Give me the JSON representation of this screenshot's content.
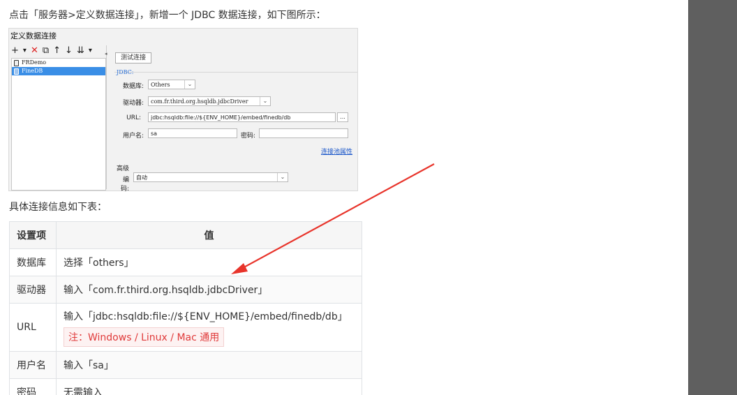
{
  "intro_text": "点击「服务器>定义数据连接」，新增一个 JDBC 数据连接，如下图所示：",
  "dialog": {
    "title": "定义数据连接",
    "toolbar": [
      "+",
      "▾",
      "✕",
      "⧉",
      "↑",
      "↓",
      "⇊",
      "▾"
    ],
    "connections": [
      {
        "name": "FRDemo",
        "selected": false
      },
      {
        "name": "FineDB",
        "selected": true
      }
    ],
    "test_button": "测试连接",
    "jdbc_legend": "JDBC:",
    "database_label": "数据库:",
    "database_value": "Others",
    "driver_label": "驱动器:",
    "driver_value": "com.fr.third.org.hsqldb.jdbcDriver",
    "url_label": "URL:",
    "url_value": "jdbc:hsqldb:file://${ENV_HOME}/embed/finedb/db",
    "url_browse": "...",
    "username_label": "用户名:",
    "username_value": "sa",
    "password_label": "密码:",
    "password_value": "",
    "pool_link": "连接池属性",
    "advanced_title": "高级",
    "encoding_label": "编码:",
    "encoding_value": "自动"
  },
  "table_intro": "具体连接信息如下表：",
  "table": {
    "headers": [
      "设置项",
      "值"
    ],
    "rows": [
      {
        "key": "数据库",
        "value": "选择「others」"
      },
      {
        "key": "驱动器",
        "value": "输入「com.fr.third.org.hsqldb.jdbcDriver」"
      },
      {
        "key": "URL",
        "value": "输入「jdbc:hsqldb:file://${ENV_HOME}/embed/finedb/db」",
        "note": "注：Windows / Linux / Mac 通用"
      },
      {
        "key": "用户名",
        "value": "输入「sa」"
      },
      {
        "key": "密码",
        "value": "无需输入"
      }
    ]
  },
  "colors": {
    "accent_red": "#e8342b",
    "link_blue": "#1a56c9",
    "selected_blue": "#3a8ee6",
    "sidebar_gray": "#5f5f5f"
  }
}
